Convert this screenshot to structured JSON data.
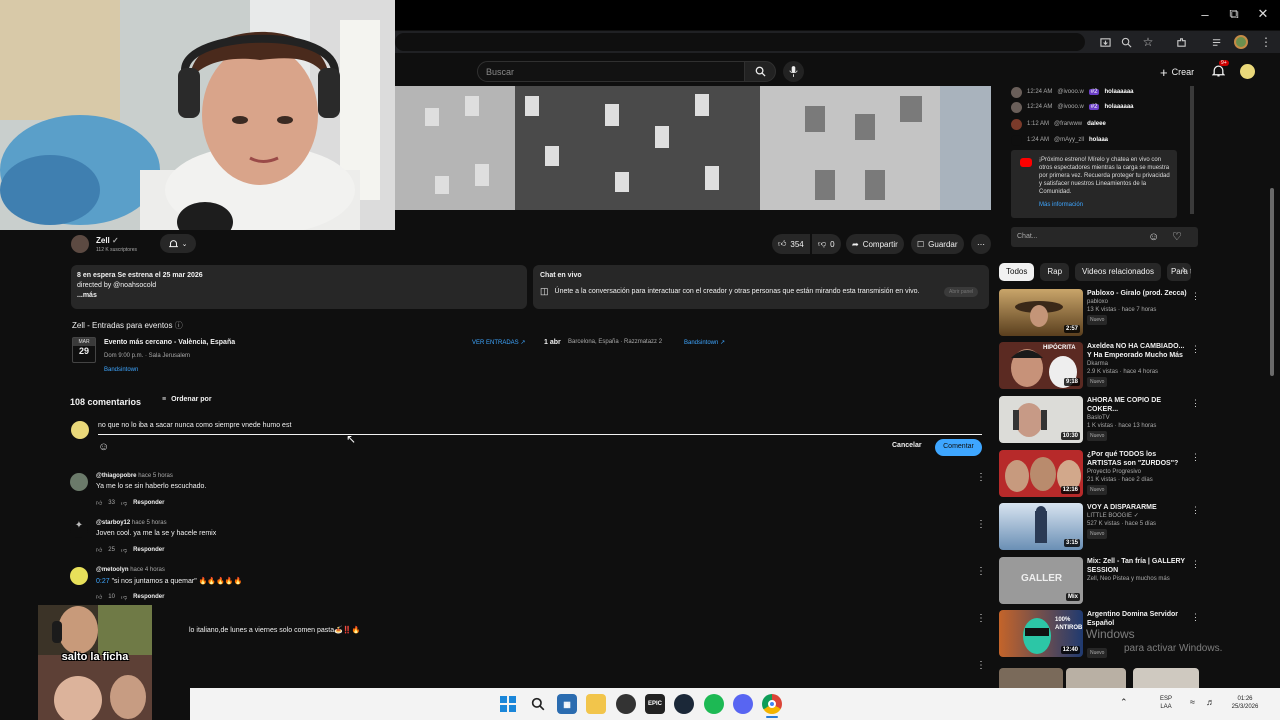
{
  "header": {
    "search_placeholder": "Buscar",
    "create_label": "Crear",
    "notif_count": "9+"
  },
  "chat": {
    "messages": [
      {
        "time": "12:24 AM",
        "user": "@ivooo.w",
        "badge": "#2",
        "text": "holaaaaaa"
      },
      {
        "time": "12:24 AM",
        "user": "@ivooo.w",
        "badge": "#2",
        "text": "holaaaaaa"
      },
      {
        "time": "1:12 AM",
        "user": "@frarwww",
        "badge": "",
        "text": "daleee"
      },
      {
        "time": "1:24 AM",
        "user": "@mAyy_zll",
        "badge": "",
        "text": "holaaa"
      }
    ],
    "premiere_notice": "¡Próximo estreno! Mírelo y chatea en vivo con otros espectadores mientras la carga se muestra por primera vez. Recuerda proteger tu privacidad y satisfacer nuestros Lineamientos de la Comunidad.",
    "more_info": "Más información",
    "input_placeholder": "Chat..."
  },
  "channel": {
    "name": "Zell",
    "subscribers": "112 K suscriptores"
  },
  "actions": {
    "likes": "354",
    "dislikes": "0",
    "share": "Compartir",
    "save": "Guardar"
  },
  "description": {
    "line1": "8 en espera  Se estrena el 25 mar 2026",
    "line2": "directed by @noahsocold",
    "more": "...más"
  },
  "live_chat": {
    "title": "Chat en vivo",
    "text": "Únete a la conversación para interactuar con el creador y otras personas que están mirando esta transmisión en vivo.",
    "button": "Abrir panel"
  },
  "events": {
    "title": "Zell - Entradas para eventos",
    "month": "MAR",
    "day": "29",
    "nearest": "Evento más cercano - València, España",
    "time_venue": "Dom 9:00 p.m. · Sala Jerusalem",
    "source": "Bandsintown",
    "tickets": "VER ENTRADAS",
    "next_date": "1 abr",
    "next_place": "Barcelona, España · Razzmatazz 2",
    "next_source": "Bandsintown"
  },
  "comments": {
    "count_label": "108 comentarios",
    "sort_label": "Ordenar por",
    "draft": "no que no lo iba a sacar nunca como siempre vnede humo est",
    "cancel": "Cancelar",
    "submit": "Comentar",
    "reply_label": "Responder",
    "items": [
      {
        "user": "@thiagopobre",
        "time": "hace 5 horas",
        "text": "Ya me lo se sin haberlo escuchado.",
        "likes": "33"
      },
      {
        "user": "@starboy12",
        "time": "hace 5 horas",
        "text": "Joven cool. ya me la se y hacele remix",
        "likes": "25"
      },
      {
        "user": "@metoolyn",
        "time": "hace 4 horas",
        "timestamp": "0:27",
        "text": " \"si nos juntamos a quemar\" 🔥🔥🔥🔥🔥",
        "likes": "10"
      },
      {
        "user": "",
        "time": "",
        "text": "lo italiano,de lunes a viernes solo comen pasta🍝‼️🔥",
        "likes": ""
      }
    ]
  },
  "filters": [
    "Todos",
    "Rap",
    "Videos relacionados",
    "Para ti"
  ],
  "recommendations": [
    {
      "title": "Pabloxo - Giralo (prod. Zecca)",
      "channel": "pabloxo",
      "meta": "13 K vistas · hace 7 horas",
      "duration": "2:57",
      "badge": "Nuevo"
    },
    {
      "title": "Axeldea NO HA CAMBIADO... Y Ha Empeorado Mucho Más",
      "channel": "Dkarma",
      "meta": "2.9 K vistas · hace 4 horas",
      "duration": "9:18",
      "badge": "Nuevo",
      "thumb_text": "HIPÓCRITA"
    },
    {
      "title": "AHORA ME COPIO DE COKER...",
      "channel": "BasloTV",
      "meta": "1 K vistas · hace 13 horas",
      "duration": "10:30",
      "badge": "Nuevo"
    },
    {
      "title": "¿Por qué TODOS los ARTISTAS son \"ZURDOS\"?",
      "channel": "Proyecto Progresivo",
      "meta": "21 K vistas · hace 2 días",
      "duration": "12:16",
      "badge": "Nuevo"
    },
    {
      "title": "VOY A DISPARARME",
      "channel": "LITTLE BOOGIE",
      "meta": "527 K vistas · hace 5 días",
      "duration": "3:15",
      "badge": "Nuevo"
    },
    {
      "title": "Mix: Zell - Tan fría | GALLERY SESSION",
      "channel": "Zell, Neo Pistea y muchos más",
      "meta": "",
      "duration": "Mix",
      "badge": "",
      "thumb_text": "GALLER"
    },
    {
      "title": "Argentino Domina Servidor Español",
      "channel": "",
      "meta": "",
      "duration": "12:40",
      "badge": "Nuevo",
      "thumb_text": "100% ANTIROB"
    }
  ],
  "watermark": {
    "line1": "Windows",
    "line2": "para activar Windows."
  },
  "meme": {
    "text": "salto la ficha"
  },
  "taskbar": {
    "lang1": "ESP",
    "lang2": "LAA",
    "time": "01:26",
    "date": "25/3/2026"
  }
}
